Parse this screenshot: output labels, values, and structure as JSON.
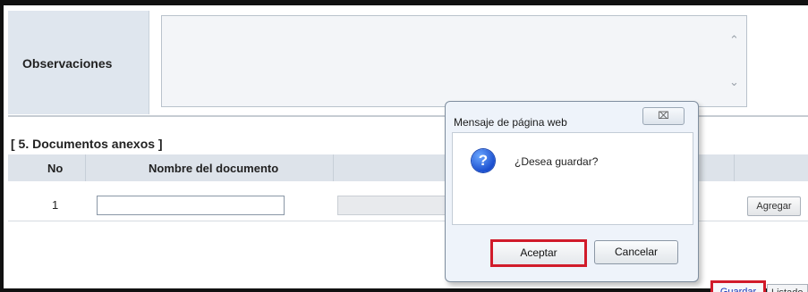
{
  "observaciones": {
    "label": "Observaciones",
    "value": "",
    "scroll_up_icon": "chevron-up-icon",
    "scroll_down_icon": "chevron-down-icon"
  },
  "documentos": {
    "section_title": "[ 5. Documentos anexos ]",
    "columns": [
      "No",
      "Nombre del documento"
    ],
    "rows": [
      {
        "no": "1",
        "nombre": ""
      }
    ],
    "add_label": "Agregar"
  },
  "actions": {
    "save_label": "Guardar",
    "list_label": "Listado"
  },
  "dialog": {
    "title": "Mensaje de página web",
    "close_symbol": "⌧",
    "icon": "question-icon",
    "icon_glyph": "?",
    "message": "¿Desea guardar?",
    "accept_label": "Aceptar",
    "cancel_label": "Cancelar"
  },
  "colors": {
    "highlight": "#d11b2a",
    "header_bg": "#dde3ea",
    "label_bg": "#dfe6ee",
    "link_blue": "#1a35b8"
  }
}
